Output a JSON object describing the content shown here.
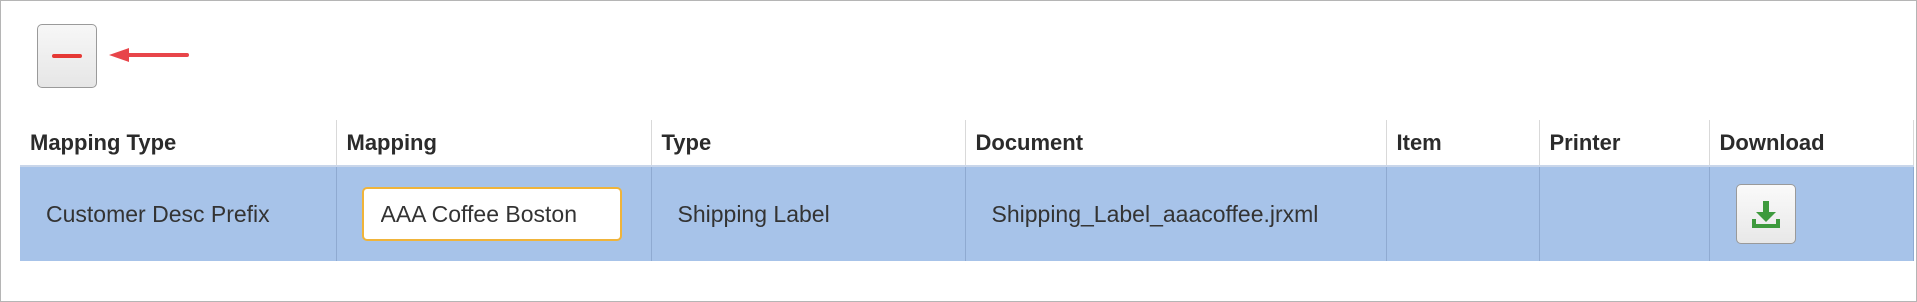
{
  "toolbar": {
    "remove_icon": "minus-icon",
    "annotation_icon": "arrow-left-icon"
  },
  "table": {
    "columns": [
      "Mapping Type",
      "Mapping",
      "Type",
      "Document",
      "Item",
      "Printer",
      "Download"
    ],
    "row": {
      "mapping_type": "Customer Desc Prefix",
      "mapping": "AAA Coffee Boston",
      "type": "Shipping Label",
      "document": "Shipping_Label_aaacoffee.jrxml",
      "item": "",
      "printer": "",
      "download_icon": "download-icon"
    }
  },
  "colors": {
    "selected_row": "#a7c3e9",
    "annotation_arrow": "#e8454a",
    "input_border": "#f0b43a",
    "download_icon": "#3d9a3d"
  }
}
